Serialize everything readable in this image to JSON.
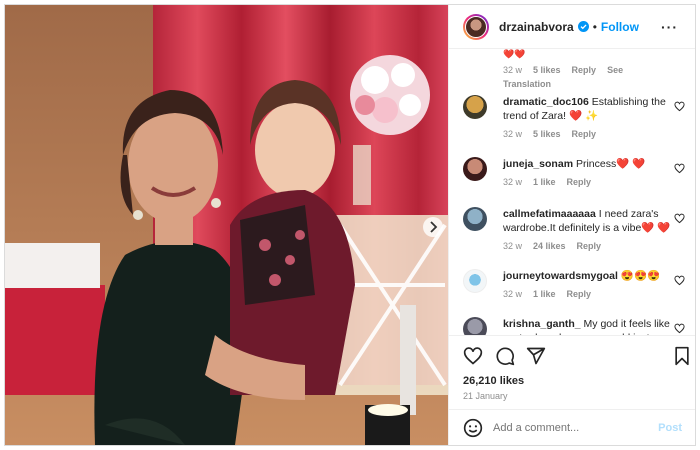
{
  "header": {
    "username": "drzainabvora",
    "separator": "•",
    "follow_label": "Follow",
    "more_label": "···"
  },
  "comments": [
    {
      "id": "c0",
      "partial": true,
      "frag": "❤️❤️",
      "age": "32 w",
      "likes": "5 likes",
      "reply": "Reply",
      "extra": "See Translation"
    },
    {
      "id": "c1",
      "user": "dramatic_doc106",
      "text": "Establishing the trend of Zara!",
      "emoji": " ❤️ ✨",
      "age": "32 w",
      "likes": "5 likes",
      "reply": "Reply"
    },
    {
      "id": "c2",
      "user": "juneja_sonam",
      "text": "Princess",
      "emoji": "❤️ ❤️",
      "age": "32 w",
      "likes": "1 like",
      "reply": "Reply"
    },
    {
      "id": "c3",
      "user": "callmefatimaaaaaa",
      "text": "I need zara's wardrobe.It definitely is a vibe",
      "emoji": "❤️ ❤️",
      "age": "32 w",
      "likes": "24 likes",
      "reply": "Reply"
    },
    {
      "id": "c4",
      "user": "journeytowardsmygoal",
      "text": "",
      "emoji": "😍😍😍",
      "age": "32 w",
      "likes": "1 like",
      "reply": "Reply"
    },
    {
      "id": "c5",
      "user": "krishna_ganth_",
      "text": "My god it feels like yesterday when zara would just",
      "emoji": "",
      "age": "",
      "likes": "",
      "reply": ""
    }
  ],
  "post": {
    "likes": "26,210 likes",
    "date": "21 January"
  },
  "add_comment": {
    "placeholder": "Add a comment...",
    "post_label": "Post"
  },
  "colors": {
    "accent": "#0095f6",
    "muted": "#8e8e8e",
    "text": "#262626",
    "heart": "#ed4956"
  },
  "icons": [
    "verified-badge-icon",
    "heart-icon",
    "comment-icon",
    "share-icon",
    "bookmark-icon",
    "emoji-icon",
    "more-icon",
    "carousel-next-icon"
  ]
}
